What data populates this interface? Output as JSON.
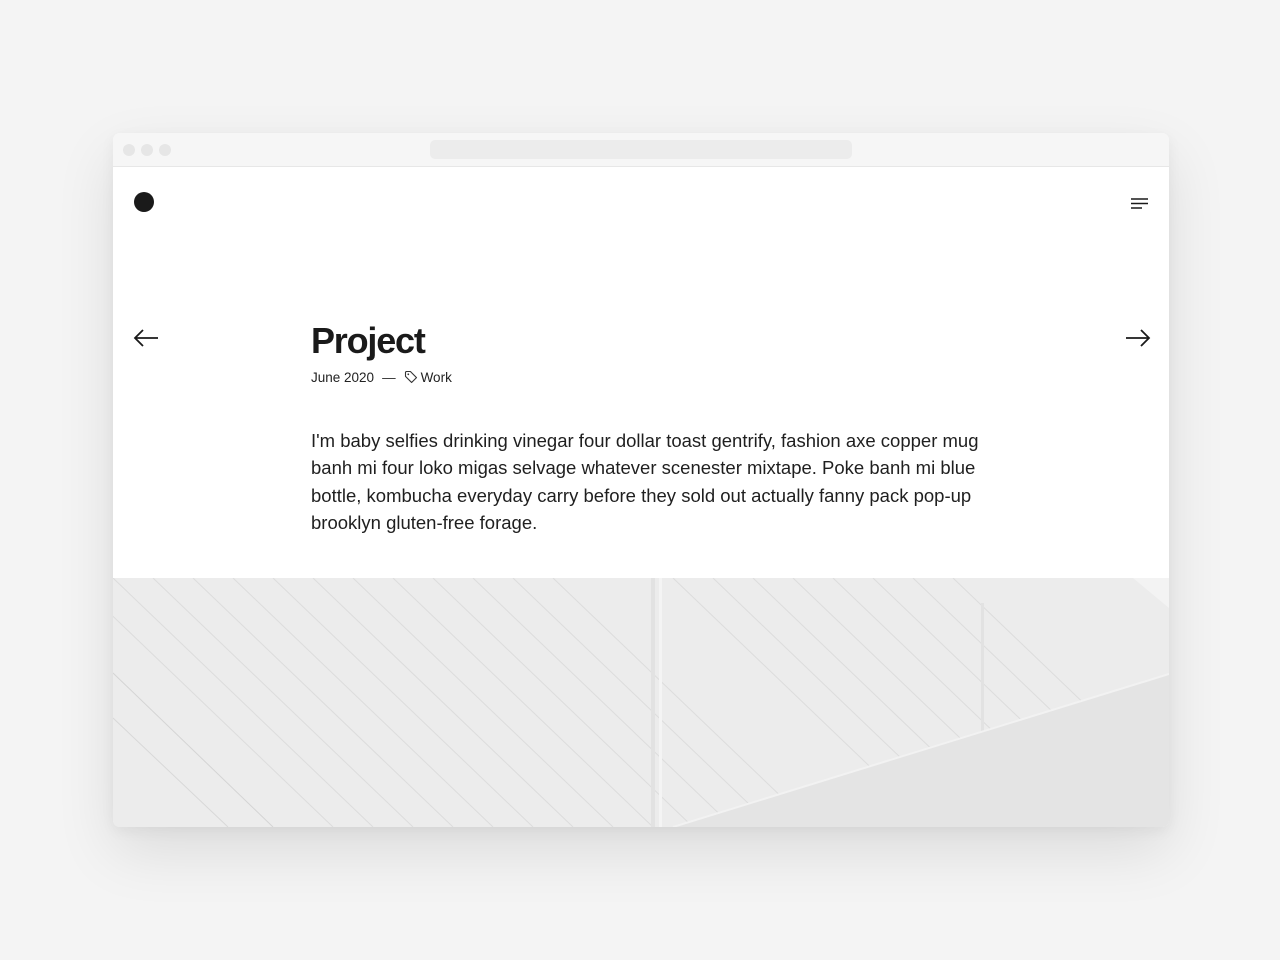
{
  "header": {
    "logo": "circle-logo",
    "menu_icon": "hamburger-menu-icon"
  },
  "nav": {
    "prev_icon": "arrow-left-icon",
    "next_icon": "arrow-right-icon"
  },
  "post": {
    "title": "Project",
    "date": "June 2020",
    "separator": "—",
    "tag_icon": "tag-icon",
    "tag": "Work",
    "body": "I'm baby selfies drinking vinegar four dollar toast gentrify, fashion axe copper mug banh mi four loko migas selvage whatever scenester mixtape. Poke banh mi blue bottle, kombucha everyday carry before they sold out actually fanny pack pop-up brooklyn gluten-free forage."
  },
  "colors": {
    "background": "#f4f4f4",
    "text": "#1a1a1a",
    "hero": "#eeeeee"
  }
}
